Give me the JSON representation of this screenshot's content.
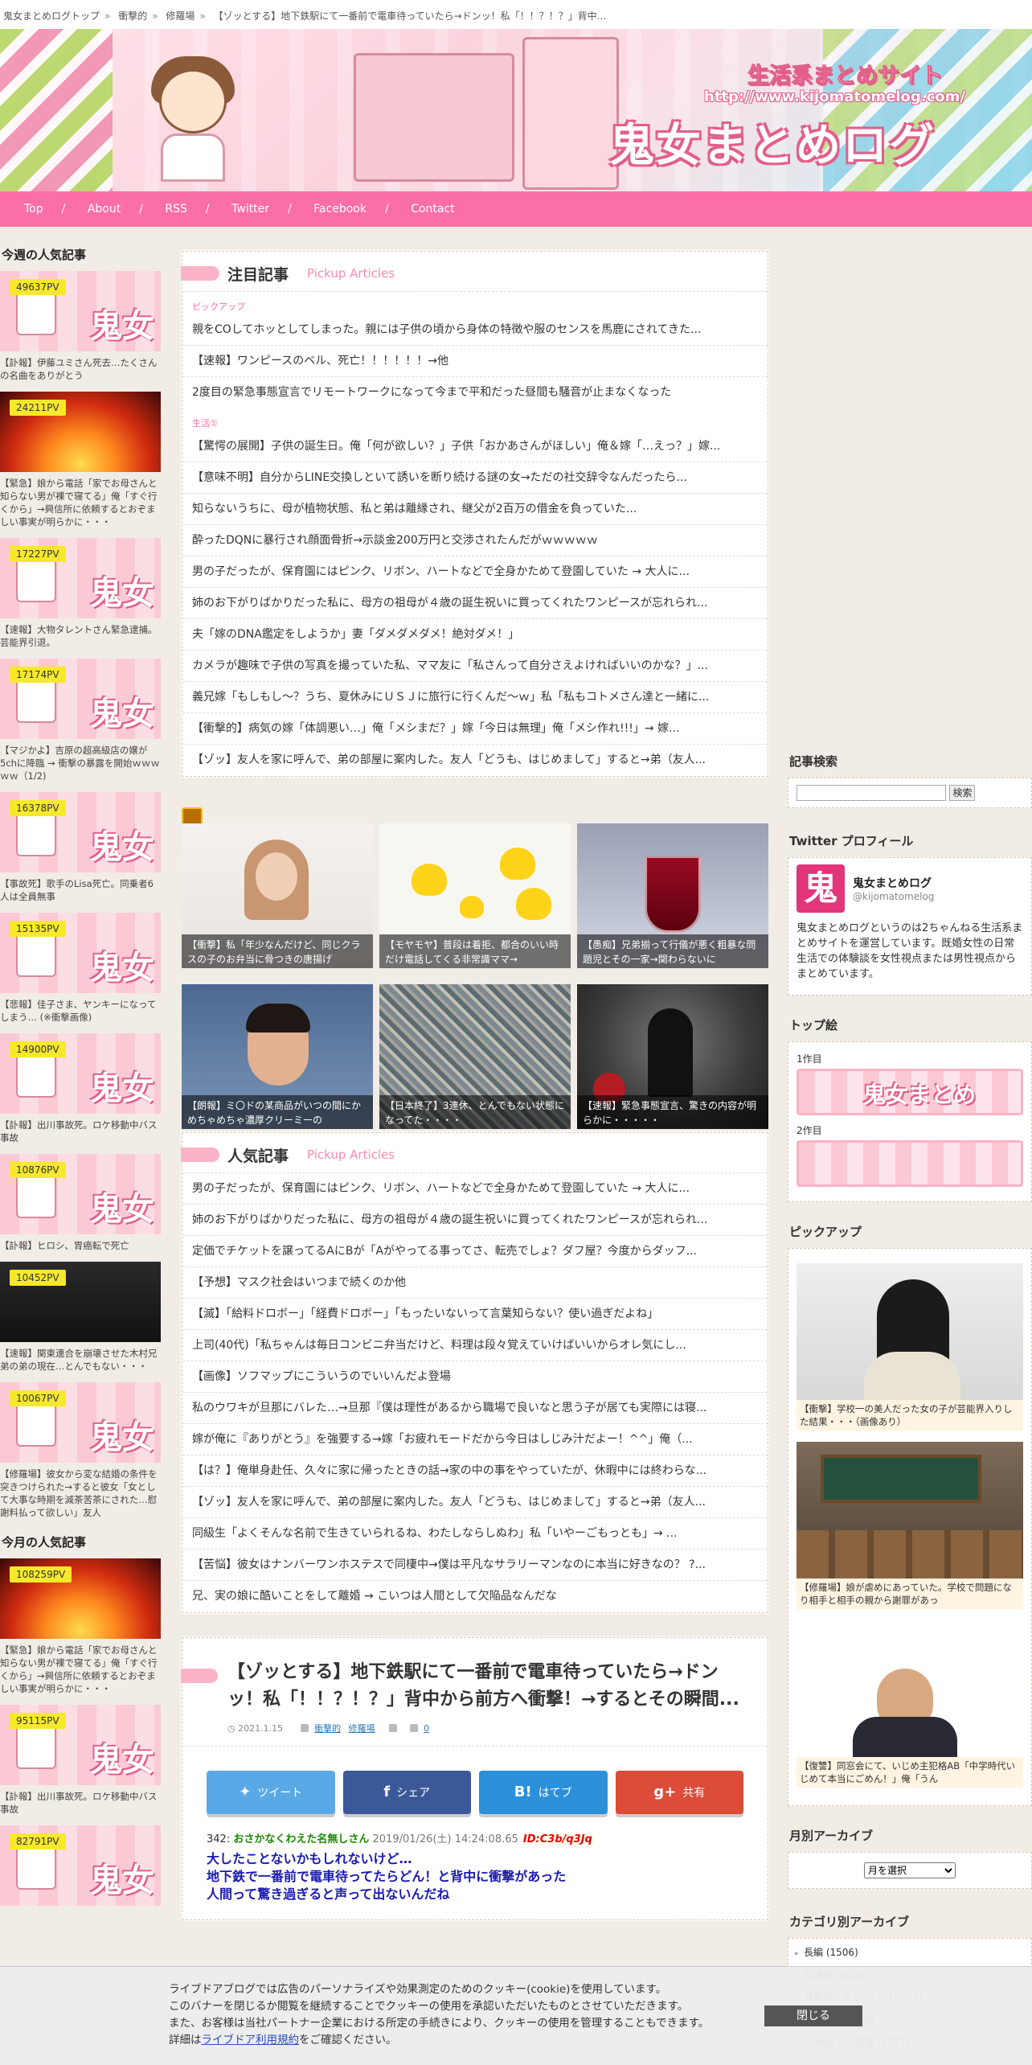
{
  "breadcrumb": [
    "鬼女まとめログトップ",
    "衝撃的",
    "修羅場",
    "【ゾッとする】地下鉄駅にて一番前で電車待っていたら→ドンッ！私「！！？！？」背中..."
  ],
  "header": {
    "subtitle": "生活系まとめサイト",
    "url": "http://www.kijomatomelog.com/",
    "logo": "鬼女まとめログ"
  },
  "nav": [
    "Top",
    "About",
    "RSS",
    "Twitter",
    "Facebook",
    "Contact"
  ],
  "left": {
    "weekly_title": "今週の人気記事",
    "weekly": [
      {
        "pv": "49637PV",
        "cap": "【訃報】伊藤ユミさん死去…たくさんの名曲をありがとう",
        "thumb": "pink"
      },
      {
        "pv": "24211PV",
        "cap": "【緊急】娘から電話「家でお母さんと知らない男が裸で寝てる」俺「すぐ行くから」→興信所に依頼するとおぞましい事実が明らかに・・・",
        "thumb": "fire"
      },
      {
        "pv": "17227PV",
        "cap": "【速報】大物タレントさん緊急逮捕。芸能界引退。",
        "thumb": "pink"
      },
      {
        "pv": "17174PV",
        "cap": "【マジかよ】吉原の超高級店の嬢が5chに降臨 → 衝撃の暴露を開始ｗｗｗｗｗ（1/2)",
        "thumb": "pink"
      },
      {
        "pv": "16378PV",
        "cap": "【事故死】歌手のLisa死亡。同乗者6人は全員無事",
        "thumb": "pink"
      },
      {
        "pv": "15135PV",
        "cap": "【悲報】佳子さま、ヤンキーになってしまう… (※衝撃画像)",
        "thumb": "pink"
      },
      {
        "pv": "14900PV",
        "cap": "【訃報】出川事故死。ロケ移動中バス事故",
        "thumb": "pink"
      },
      {
        "pv": "10876PV",
        "cap": "【訃報】ヒロシ、胃癌転で死亡",
        "thumb": "pink"
      },
      {
        "pv": "10452PV",
        "cap": "【速報】関東連合を崩壊させた木村兄弟の弟の現在…とんでもない・・・",
        "thumb": "dark"
      },
      {
        "pv": "10067PV",
        "cap": "【修羅場】彼女から変な結婚の条件を突きつけられた→すると彼女「女として大事な時期を減茶苦茶にされた…慰謝料払って欲しい」友人",
        "thumb": "pink"
      }
    ],
    "monthly_title": "今月の人気記事",
    "monthly": [
      {
        "pv": "108259PV",
        "cap": "【緊急】娘から電話「家でお母さんと知らない男が裸で寝てる」俺「すぐ行くから」→興信所に依頼するとおぞましい事実が明らかに・・・",
        "thumb": "fire"
      },
      {
        "pv": "95115PV",
        "cap": "【訃報】出川事故死。ロケ移動中バス事故",
        "thumb": "pink"
      },
      {
        "pv": "82791PV",
        "cap": "",
        "thumb": "pink"
      }
    ]
  },
  "pickup": {
    "title": "注目記事",
    "title_en": "Pickup Articles",
    "label1": "ピックアップ",
    "items1": [
      "親をCOしてホッとしてしまった。親には子供の頃から身体の特徴や服のセンスを馬鹿にされてきた...",
      "【速報】ワンピースのベル、死亡！！！！！！→他",
      "2度目の緊急事態宣言でリモートワークになって今まで平和だった昼間も騒音が止まなくなった"
    ],
    "label2": "生活①",
    "items2": [
      "【驚愕の展開】子供の誕生日。俺「何が欲しい？」子供「おかあさんがほしい」俺＆嫁「…えっ？」嫁...",
      "【意味不明】自分からLINE交換しといて誘いを断り続ける謎の女→ただの社交辞令なんだったら...",
      "知らないうちに、母が植物状態、私と弟は離縁され、継父が2百万の借金を負っていた...",
      "酔ったDQNに暴行され顔面骨折→示談金200万円と交渉されたんだがｗｗｗｗｗ",
      "男の子だったが、保育園にはピンク、リボン、ハートなどで全身かためて登園していた → 大人に...",
      "姉のお下がりばかりだった私に、母方の祖母が４歳の誕生祝いに買ってくれたワンピースが忘れられ...",
      "夫「嫁のDNA鑑定をしようか」妻「ダメダメダメ！絶対ダメ！」",
      "カメラが趣味で子供の写真を撮っていた私、ママ友に「私さんって自分さえよければいいのかな？」...",
      "義兄嫁「もしもし～？うち、夏休みにＵＳＪに旅行に行くんだ～ｗ」私「私もコトメさん達と一緒に...",
      "【衝撃的】病気の嫁「体調悪い…」俺「メシまだ？」嫁「今日は無理」俺「メシ作れ!!!」→ 嫁...",
      "【ゾッ】友人を家に呼んで、弟の部屋に案内した。友人「どうも、はじめまして」すると→弟（友人..."
    ]
  },
  "tiles": [
    "【衝撃】私「年少なんだけど、同じクラスの子のお弁当に骨つきの唐揚げ",
    "【モヤモヤ】普段は着拒、都合のいい時だけ電話してくる非常識ママ→",
    "【愚痴】兄弟揃って行儀が悪く粗暴な問題児とその一家→関わらないに",
    "【朗報】ミ〇ドの某商品がいつの間にかめちゃめちゃ濃厚クリーミーの",
    "【日本終了】3連休、とんでもない状態になってた・・・・",
    "【速報】緊急事態宣言、驚きの内容が明らかに・・・・・"
  ],
  "popular": {
    "title": "人気記事",
    "title_en": "Pickup Articles",
    "items": [
      "男の子だったが、保育園にはピンク、リボン、ハートなどで全身かためて登園していた → 大人に...",
      "姉のお下がりばかりだった私に、母方の祖母が４歳の誕生祝いに買ってくれたワンピースが忘れられ...",
      "定価でチケットを譲ってるAにBが「Aがやってる事ってさ、転売でしょ？ダフ屋？今度からダッフ...",
      "【予想】マスク社会はいつまで続くのか他",
      "【滅】「給料ドロボー」「経費ドロボー」「もったいないって言葉知らない？使い過ぎだよね」",
      "上司(40代)「私ちゃんは毎日コンビニ弁当だけど、料理は段々覚えていけばいいからオレ気にし...",
      "【画像】ソフマップにこういうのでいいんだよ登場",
      "私のウワキが旦那にバレた…→旦那『僕は理性があるから職場で良いなと思う子が居ても実際には寝...",
      "嫁が俺に『ありがとう』を強要する→嫁「お疲れモードだから今日はしじみ汁だよー！^^」俺（...",
      "【は？】俺単身赴任、久々に家に帰ったときの話→家の中の事をやっていたが、休暇中には終わらな...",
      "【ゾッ】友人を家に呼んで、弟の部屋に案内した。友人「どうも、はじめまして」すると→弟（友人...",
      "同級生「よくそんな名前で生きていられるね、わたしならしぬわ」私「いやーごもっとも」→ ...",
      "【苦悩】彼女はナンバーワンホステスで同棲中→僕は平凡なサラリーマンなのに本当に好きなの？ ?...",
      "兄、実の娘に酷いことをして離婚 → こいつは人間として欠陥品なんだな"
    ]
  },
  "article": {
    "title": "【ゾッとする】地下鉄駅にて一番前で電車待っていたら→ドンッ！私「！！？！？」背中から前方へ衝撃！→するとその瞬間...",
    "date": "2021.1.15",
    "cat1": "衝撃的",
    "cat2": "修羅場",
    "comments": "0",
    "share": {
      "tw": "ツイート",
      "fb": "シェア",
      "hb": "はてブ",
      "gp": "共有"
    },
    "comment": {
      "no": "342:",
      "name": "おさかなくわえた名無しさん",
      "date": "2019/01/26(土) 14:24:08.65",
      "id": "ID:C3b/q3Jq",
      "body": "大したことないかもしれないけど…\n地下鉄で一番前で電車待ってたらどん！と背中に衝撃があった\n人間って驚き過ぎると声って出ないんだね"
    }
  },
  "right": {
    "search_title": "記事検索",
    "search_btn": "検索",
    "twitter_title": "Twitter プロフィール",
    "tw_name": "鬼女まとめログ",
    "tw_handle": "@kijomatomelog",
    "tw_avatar": "鬼",
    "tw_desc": "鬼女まとめログというのは2ちゃんねる生活系まとめサイトを運営しています。既婚女性の日常生活での体験談を女性視点または男性視点からまとめています。",
    "top_title": "トップ絵",
    "top1": "1作目",
    "top2": "2作目",
    "banner_logo": "鬼女まとめ",
    "pickup_title": "ピックアップ",
    "picks": [
      "【衝撃】学校一の美人だった女の子が芸能界入りした結果・・・（画像あり）",
      "【修羅場】娘が虐めにあっていた。学校で問題になり相手と相手の親から謝罪があっ",
      "【復讐】同窓会にて、いじめ主犯格AB「中学時代いじめて本当にごめん！」俺「うん"
    ],
    "archive_title": "月別アーカイブ",
    "archive_select": "月を選択",
    "cat_title": "カテゴリ別アーカイブ",
    "cats": [
      "長編 (1506)",
      "修羅場 (6008)",
      "非常識・おかしい (13326)",
      "衝撃的 (14148)",
      "DQN返し・復讐 (1357)"
    ]
  },
  "cookie": {
    "l1": "ライブドアブログでは広告のパーソナライズや効果測定のためのクッキー(cookie)を使用しています。",
    "l2": "このバナーを閉じるか閲覧を継続することでクッキーの使用を承認いただいたものとさせていただきます。",
    "l3": "また、お客様は当社パートナー企業における所定の手続きにより、クッキーの使用を管理することもできます。",
    "l4a": "詳細は",
    "link": "ライブドア利用規約",
    "l4b": "をご確認ください。",
    "close": "閉じる"
  }
}
